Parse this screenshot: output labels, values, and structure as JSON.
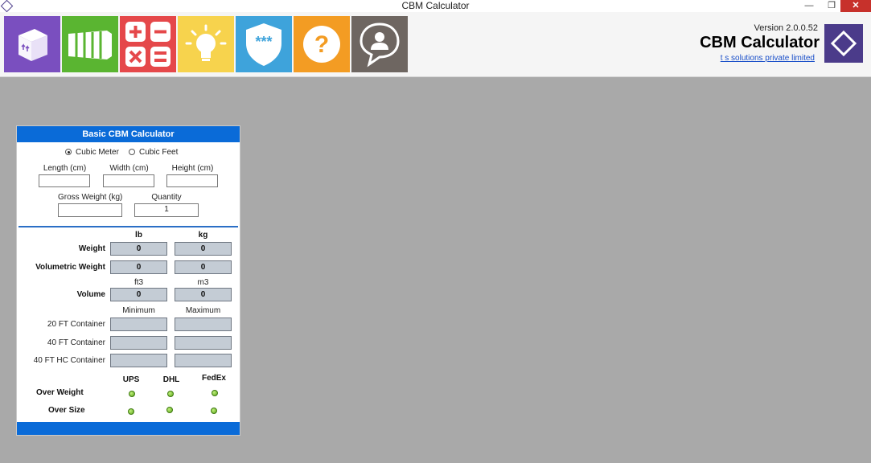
{
  "window": {
    "title": "CBM Calculator",
    "minimize": "—",
    "maximize": "❐",
    "close": "✕"
  },
  "toolbar": {
    "tiles": [
      {
        "name": "box",
        "color": "#7a4fbf"
      },
      {
        "name": "container",
        "color": "#5ab531"
      },
      {
        "name": "calculator",
        "color": "#e5484a"
      },
      {
        "name": "light-bulb",
        "color": "#f7d34d"
      },
      {
        "name": "password-shield",
        "color": "#3ea3db"
      },
      {
        "name": "help",
        "color": "#f39c23"
      },
      {
        "name": "feedback",
        "color": "#6e6661"
      }
    ]
  },
  "branding": {
    "version": "Version 2.0.0.52",
    "app_name": "CBM Calculator",
    "company": "t s solutions private limited"
  },
  "calculator": {
    "title": "Basic CBM Calculator",
    "unit_options": [
      "Cubic Meter",
      "Cubic Feet"
    ],
    "selected_unit": "Cubic Meter",
    "length_label": "Length (cm)",
    "width_label": "Width (cm)",
    "height_label": "Height (cm)",
    "length_value": "",
    "width_value": "",
    "height_value": "",
    "gross_weight_label": "Gross Weight (kg)",
    "gross_weight_value": "",
    "quantity_label": "Quantity",
    "quantity_value": "1",
    "col_lb": "lb",
    "col_kg": "kg",
    "weight_label": "Weight",
    "weight_lb": "0",
    "weight_kg": "0",
    "volumetric_label": "Volumetric Weight",
    "volumetric_lb": "0",
    "volumetric_kg": "0",
    "col_ft3": "ft3",
    "col_m3": "m3",
    "volume_label": "Volume",
    "volume_ft3": "0",
    "volume_m3": "0",
    "col_min": "Minimum",
    "col_max": "Maximum",
    "containers": [
      {
        "label": "20 FT Container",
        "min": "",
        "max": ""
      },
      {
        "label": "40 FT Container",
        "min": "",
        "max": ""
      },
      {
        "label": "40 FT HC Container",
        "min": "",
        "max": ""
      }
    ],
    "carriers": [
      "UPS",
      "DHL",
      "FedEx"
    ],
    "over_weight_label": "Over Weight",
    "over_size_label": "Over Size",
    "indicator_color": "#7cc42b"
  }
}
